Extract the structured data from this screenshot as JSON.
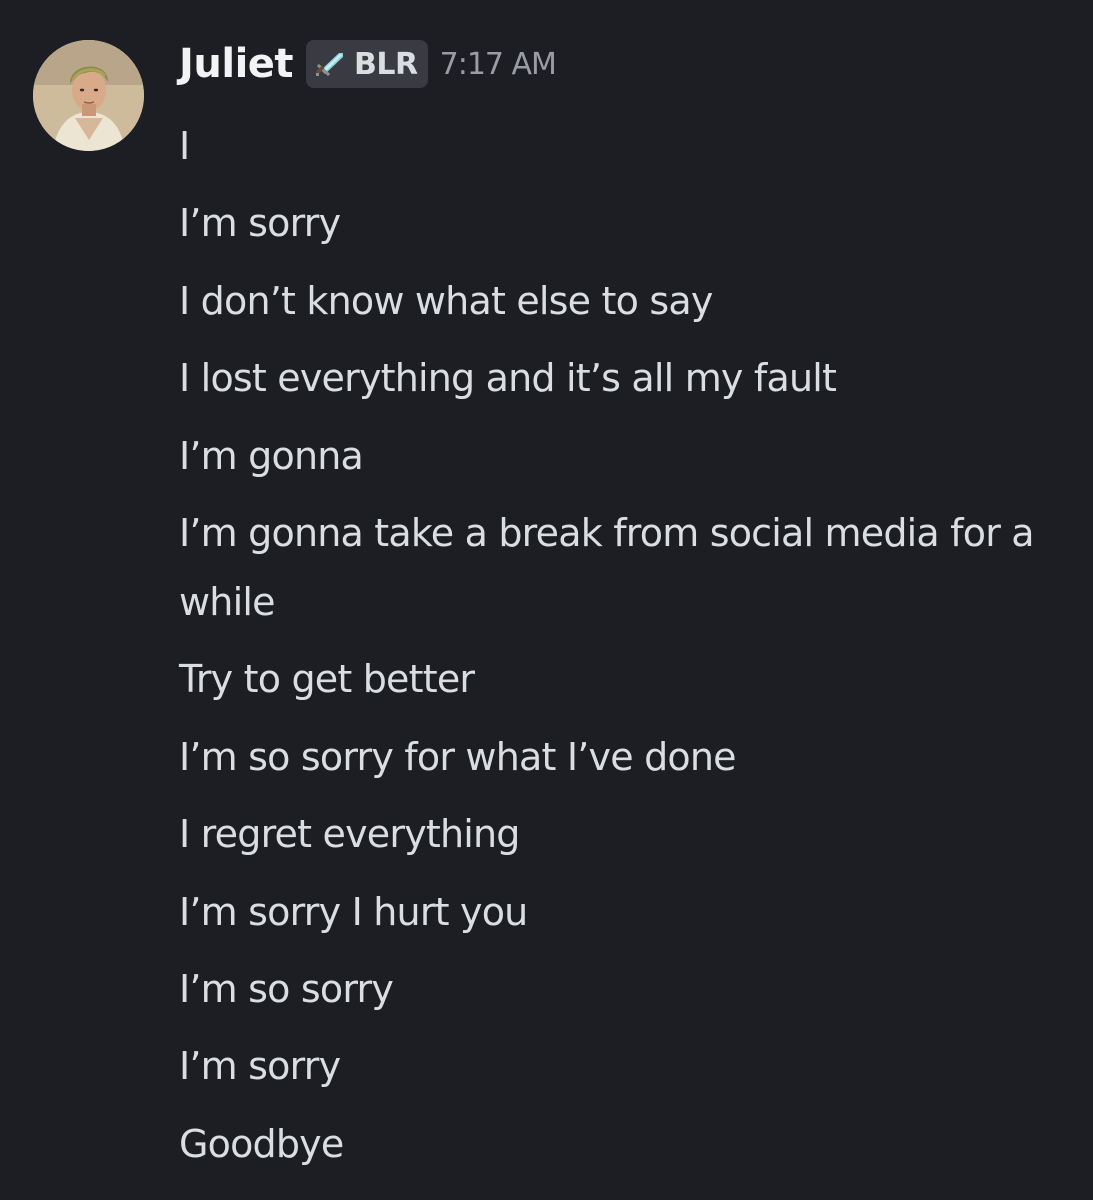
{
  "message": {
    "author": {
      "name": "Juliet",
      "tag_label": "BLR",
      "tag_icon": "sword-icon"
    },
    "timestamp": "7:17 AM",
    "lines": [
      "I",
      "I’m sorry",
      "I don’t know what else to say",
      "I lost everything and it’s all my fault",
      "I’m gonna",
      "I’m gonna take a break from social media for a while",
      "Try to get better",
      "I’m so sorry for what I’ve done",
      "I regret everything",
      "I’m sorry I hurt you",
      "I’m so sorry",
      "I’m sorry",
      "Goodbye"
    ]
  },
  "colors": {
    "background": "#1d1e23",
    "username": "#f2f3f5",
    "message_text": "#dbdee1",
    "timestamp": "#9a9ca3",
    "tag_background": "#3a3b42"
  }
}
